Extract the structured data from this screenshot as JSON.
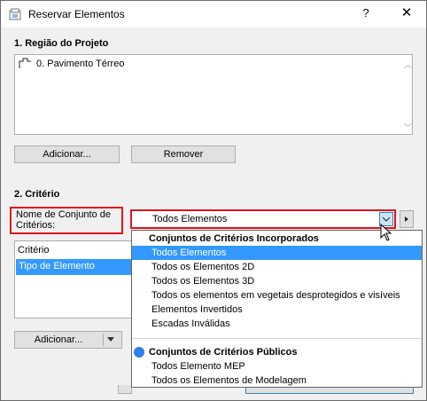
{
  "window": {
    "title": "Reservar Elementos",
    "help": "?",
    "close": "✕"
  },
  "region": {
    "title": "1. Região do Projeto",
    "items": [
      "0. Pavimento Térreo"
    ],
    "add_label": "Adicionar...",
    "remove_label": "Remover"
  },
  "criteria": {
    "title": "2. Critério",
    "set_label": "Nome de Conjunto de Critérios:",
    "selected_value": "Todos Elementos",
    "list_header": "Critério",
    "list_items": [
      "Tipo de Elemento"
    ],
    "add_label": "Adicionar..."
  },
  "dropdown": {
    "builtin_header": "Conjuntos de Critérios Incorporados",
    "builtin_items": [
      "Todos Elementos",
      "Todos os Elementos 2D",
      "Todos os Elementos 3D",
      "Todos os elementos em vegetais desprotegidos e visíveis",
      "Elementos Invertidos",
      "Escadas Inválidas"
    ],
    "public_header": "Conjuntos de Critérios Públicos",
    "public_items": [
      "Todos Elemento MEP",
      "Todos os Elementos de Modelagem"
    ],
    "selected_index": 0,
    "accent": "#3399ff",
    "highlight_border": "#e0141e"
  }
}
